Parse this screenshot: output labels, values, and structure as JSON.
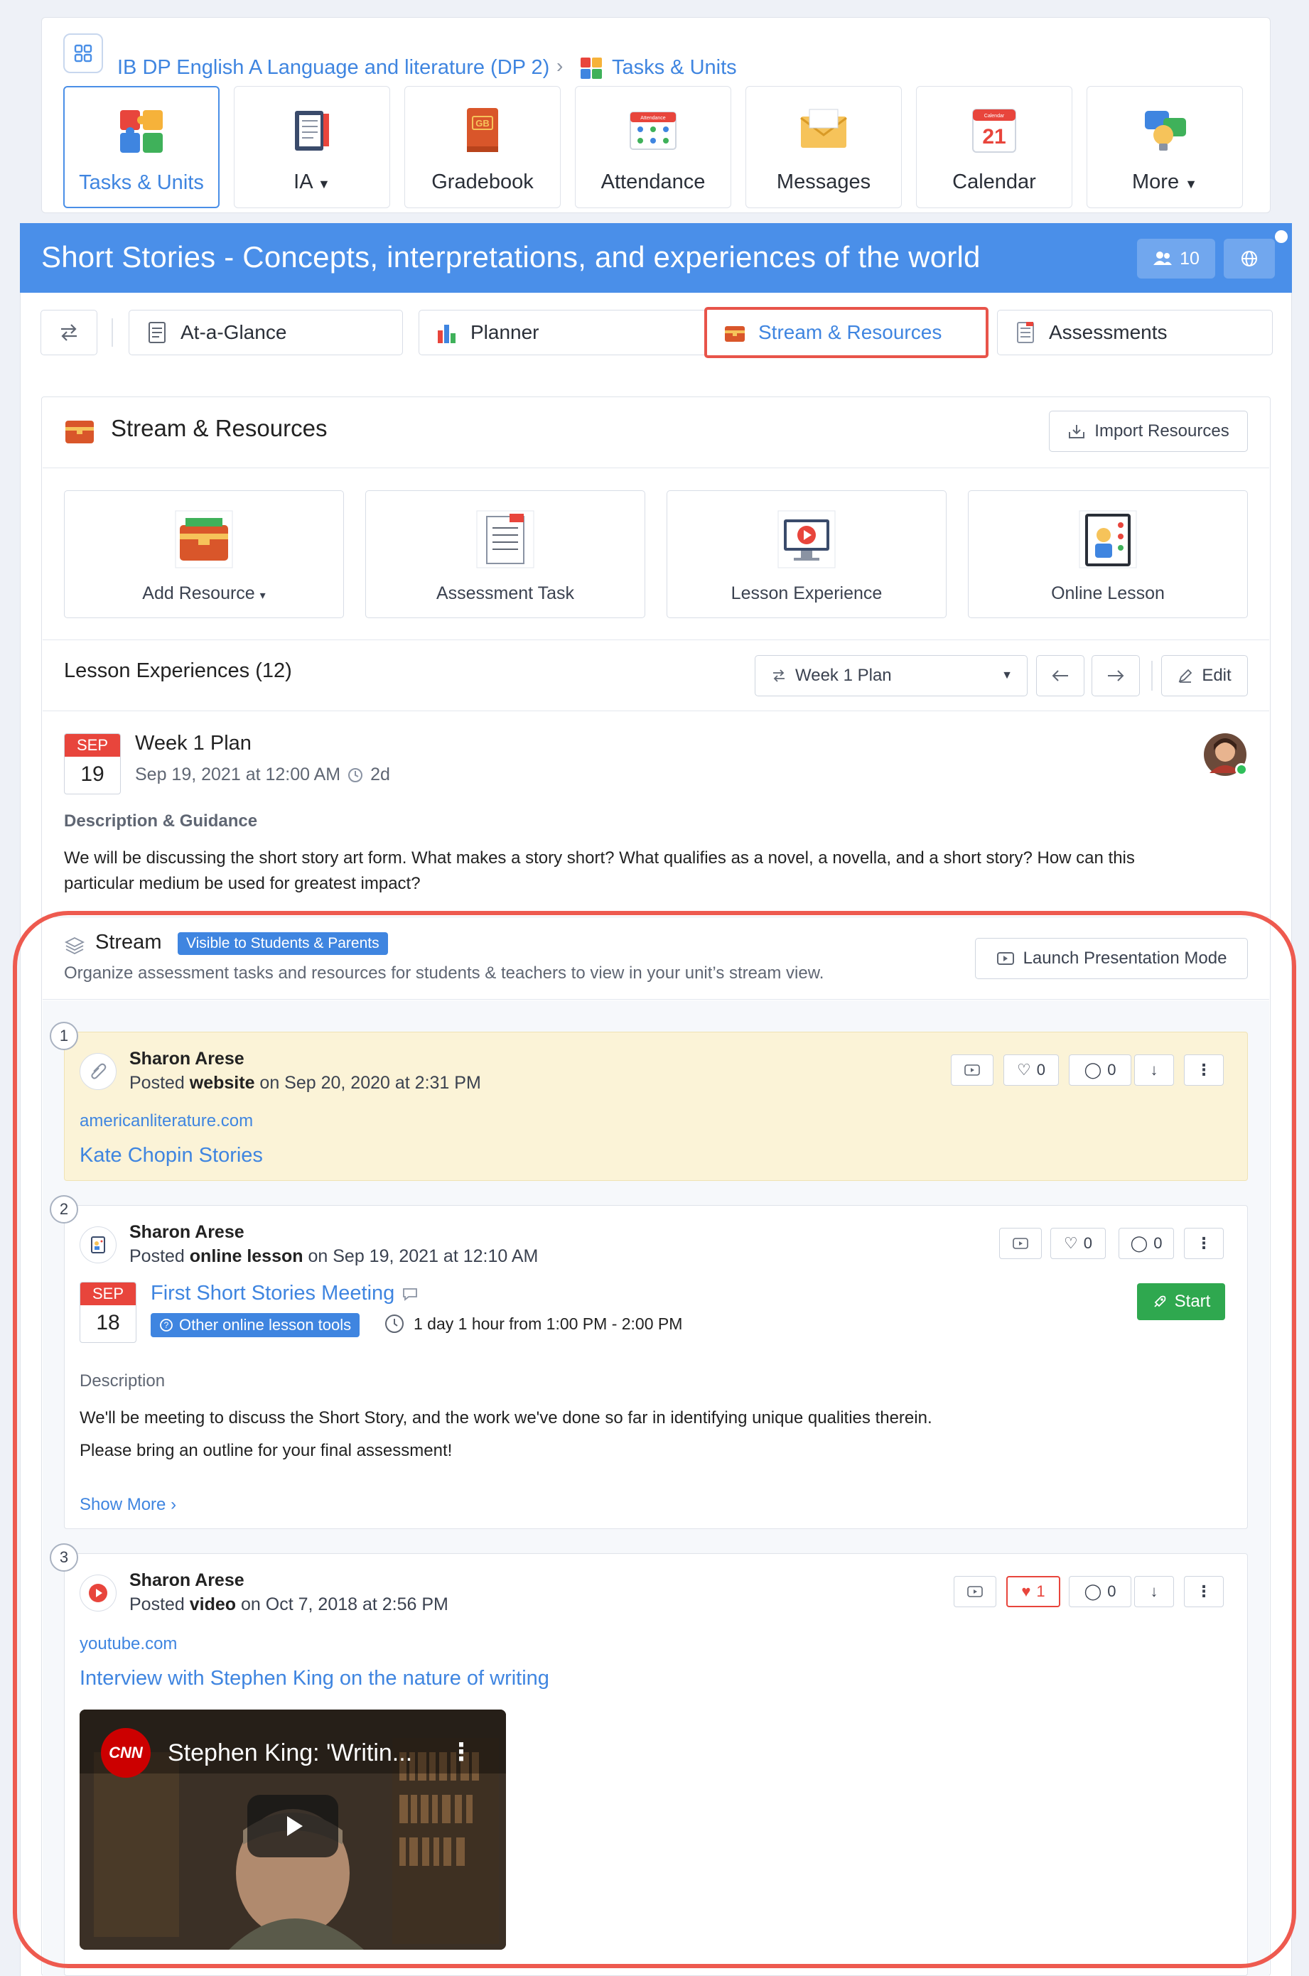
{
  "breadcrumb": {
    "course": "IB DP English A Language and literature (DP 2)",
    "separator": "›",
    "current": "Tasks & Units"
  },
  "nav": [
    {
      "label": "Tasks & Units",
      "icon": "puzzle-icon"
    },
    {
      "label": "IA",
      "icon": "notebook-icon"
    },
    {
      "label": "Gradebook",
      "icon": "gradebook-icon"
    },
    {
      "label": "Attendance",
      "icon": "attendance-icon"
    },
    {
      "label": "Messages",
      "icon": "envelope-icon"
    },
    {
      "label": "Calendar",
      "icon": "calendar-icon"
    },
    {
      "label": "More",
      "icon": "more-icon"
    }
  ],
  "nav_icon_text": {
    "gradebook": "GB",
    "calendar_day": "21",
    "attendance": "Attendance",
    "calendar_top": "Calendar"
  },
  "unit": {
    "title": "Short Stories - Concepts, interpretations, and experiences of the world",
    "members": "10"
  },
  "tabs": [
    {
      "label": "At-a-Glance"
    },
    {
      "label": "Planner"
    },
    {
      "label": "Stream & Resources"
    },
    {
      "label": "Assessments"
    }
  ],
  "stream_resources": {
    "title": "Stream & Resources",
    "import_label": "Import Resources",
    "tiles": [
      {
        "label": "Add Resource"
      },
      {
        "label": "Assessment Task"
      },
      {
        "label": "Lesson Experience"
      },
      {
        "label": "Online Lesson"
      }
    ]
  },
  "lessons": {
    "heading": "Lesson Experiences (12)",
    "plan_select": "Week 1 Plan",
    "edit_label": "Edit"
  },
  "week": {
    "month": "SEP",
    "day": "19",
    "title": "Week 1 Plan",
    "date": "Sep 19, 2021 at 12:00 AM",
    "duration": "2d",
    "desc_heading": "Description & Guidance",
    "desc_line1": "We will be discussing the short story art form. What makes a story short? What qualifies as a novel, a novella, and a short story? How can this",
    "desc_line2": "particular medium be used for greatest impact?"
  },
  "stream": {
    "title": "Stream",
    "visibility": "Visible to Students & Parents",
    "subtitle": "Organize assessment tasks and resources for students & teachers to view in your unit’s stream view.",
    "launch_label": "Launch Presentation Mode"
  },
  "posts": [
    {
      "num": "1",
      "author": "Sharon Arese",
      "posted_prefix": "Posted ",
      "type": "website",
      "posted_suffix": " on Sep 20, 2020 at 2:31 PM",
      "domain": "americanliterature.com",
      "link": "Kate Chopin Stories",
      "likes": "0",
      "comments": "0"
    },
    {
      "num": "2",
      "author": "Sharon Arese",
      "posted_prefix": "Posted ",
      "type": "online lesson",
      "posted_suffix": " on Sep 19, 2021 at 12:10 AM",
      "month": "SEP",
      "day": "18",
      "link": "First Short Stories Meeting",
      "tools": "Other online lesson tools",
      "time": "1 day 1 hour from 1:00 PM - 2:00 PM",
      "start": "Start",
      "desc_heading": "Description",
      "desc_line1": "We'll be meeting to discuss the Short Story, and the work we've done so far in identifying unique qualities therein.",
      "desc_line2": "Please bring an outline for your final assessment!",
      "show_more": "Show More",
      "likes": "0",
      "comments": "0"
    },
    {
      "num": "3",
      "author": "Sharon Arese",
      "posted_prefix": "Posted ",
      "type": "video",
      "posted_suffix": " on Oct 7, 2018 at 2:56 PM",
      "domain": "youtube.com",
      "link": "Interview with Stephen King on the nature of writing",
      "video_title": "Stephen King: 'Writin...",
      "video_logo": "CNN",
      "likes": "1",
      "comments": "0"
    }
  ],
  "colors": {
    "accent": "#3f85e0",
    "header": "#4a8fe9",
    "highlight": "#e8544a",
    "start": "#2fa84f",
    "post_yellow": "#fbf3d7"
  }
}
